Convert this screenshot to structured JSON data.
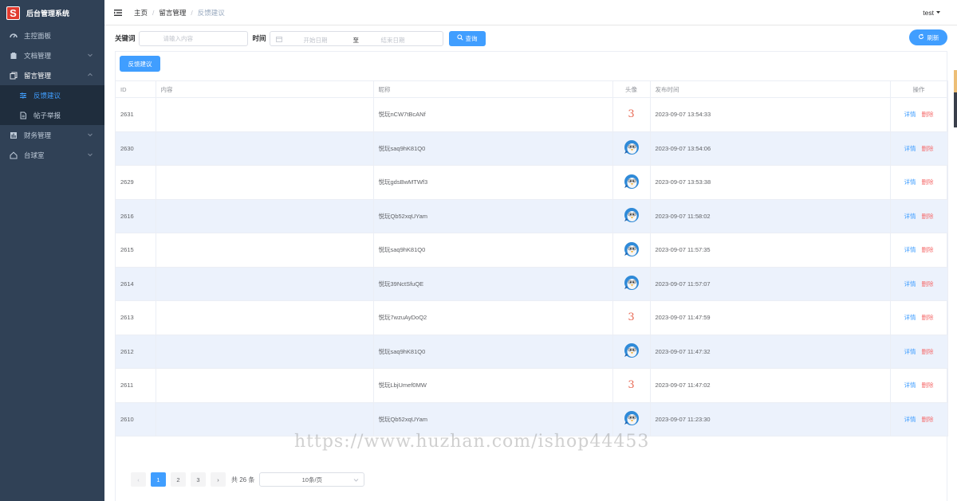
{
  "app": {
    "logo_letter": "S",
    "title": "后台管理系统"
  },
  "sidebar": {
    "items": [
      {
        "label": "主控面板",
        "icon": "dashboard-icon"
      },
      {
        "label": "文档管理",
        "icon": "document-icon"
      },
      {
        "label": "留言管理",
        "icon": "message-icon"
      },
      {
        "label": "财务管理",
        "icon": "finance-icon"
      },
      {
        "label": "台球室",
        "icon": "home-icon"
      }
    ],
    "submenu": [
      {
        "label": "反馈建议",
        "icon": "sliders-icon"
      },
      {
        "label": "帖子举报",
        "icon": "file-icon"
      }
    ]
  },
  "header": {
    "breadcrumb": [
      "主页",
      "留言管理",
      "反馈建议"
    ],
    "separator": "/",
    "user": "test"
  },
  "filters": {
    "keyword_label": "关键词",
    "keyword_placeholder": "请输入内容",
    "time_label": "时间",
    "start_placeholder": "开始日期",
    "range_sep": "至",
    "end_placeholder": "结束日期",
    "search_button": "查询",
    "refresh_button": "刷新"
  },
  "panel": {
    "feedback_button": "反馈建议"
  },
  "table": {
    "columns": [
      "ID",
      "内容",
      "昵称",
      "头像",
      "发布时间",
      "操作"
    ],
    "detail_label": "详情",
    "delete_label": "删除",
    "rows": [
      {
        "id": "2631",
        "content": "",
        "nickname": "悦玩nCW7tBcANf",
        "avatar": "3",
        "time": "2023-09-07 13:54:33"
      },
      {
        "id": "2630",
        "content": "",
        "nickname": "悦玩saq9hK81Q0",
        "avatar": "bird",
        "time": "2023-09-07 13:54:06"
      },
      {
        "id": "2629",
        "content": "",
        "nickname": "悦玩gdsBwMTWf3",
        "avatar": "bird",
        "time": "2023-09-07 13:53:38"
      },
      {
        "id": "2616",
        "content": "",
        "nickname": "悦玩Qb52xqUYam",
        "avatar": "bird",
        "time": "2023-09-07 11:58:02"
      },
      {
        "id": "2615",
        "content": "",
        "nickname": "悦玩saq9hK81Q0",
        "avatar": "bird",
        "time": "2023-09-07 11:57:35"
      },
      {
        "id": "2614",
        "content": "",
        "nickname": "悦玩39NctSfuQE",
        "avatar": "bird",
        "time": "2023-09-07 11:57:07"
      },
      {
        "id": "2613",
        "content": "",
        "nickname": "悦玩7wzuAyDoQ2",
        "avatar": "3",
        "time": "2023-09-07 11:47:59"
      },
      {
        "id": "2612",
        "content": "",
        "nickname": "悦玩saq9hK81Q0",
        "avatar": "bird",
        "time": "2023-09-07 11:47:32"
      },
      {
        "id": "2611",
        "content": "",
        "nickname": "悦玩LbjUmef0MW",
        "avatar": "3",
        "time": "2023-09-07 11:47:02"
      },
      {
        "id": "2610",
        "content": "",
        "nickname": "悦玩Qb52xqUYam",
        "avatar": "bird",
        "time": "2023-09-07 11:23:30"
      }
    ]
  },
  "pagination": {
    "pages": [
      "1",
      "2",
      "3"
    ],
    "current": "1",
    "prev": "‹",
    "next": "›",
    "total": "共 26 条",
    "page_size": "10条/页"
  },
  "watermark": "https://www.huzhan.com/ishop44453",
  "colors": {
    "primary": "#409eff",
    "danger": "#f56c6c",
    "sidebar_bg": "#304156",
    "logo_red": "#e23a2e"
  }
}
